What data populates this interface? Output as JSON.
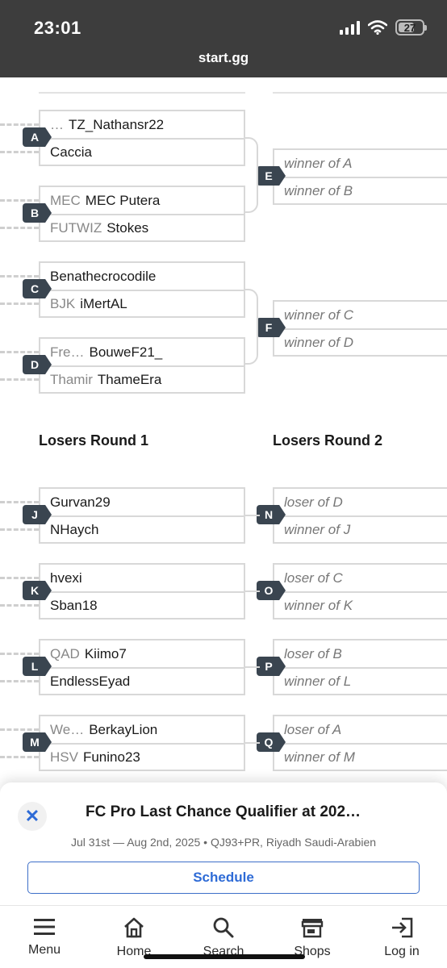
{
  "status": {
    "time": "23:01",
    "battery": "27"
  },
  "browser": {
    "url": "start.gg"
  },
  "bracket": {
    "round1": [
      {
        "id": "A",
        "p1": {
          "prefix": "…",
          "name": "TZ_Nathansr22"
        },
        "p2": {
          "prefix": "",
          "name": "Caccia"
        }
      },
      {
        "id": "B",
        "p1": {
          "prefix": "MEC",
          "name": "MEC Putera"
        },
        "p2": {
          "prefix": "FUTWIZ",
          "name": "Stokes"
        }
      },
      {
        "id": "C",
        "p1": {
          "prefix": "",
          "name": "Benathecrocodile"
        },
        "p2": {
          "prefix": "BJK",
          "name": "iMertAL"
        }
      },
      {
        "id": "D",
        "p1": {
          "prefix": "Fre…",
          "name": "BouweF21_"
        },
        "p2": {
          "prefix": "Thamir",
          "name": "ThameEra"
        }
      }
    ],
    "round2": [
      {
        "id": "E",
        "s1": "winner of A",
        "s2": "winner of B"
      },
      {
        "id": "F",
        "s1": "winner of C",
        "s2": "winner of D"
      }
    ],
    "losers_round1_title": "Losers Round 1",
    "losers_round2_title": "Losers Round 2",
    "losers1": [
      {
        "id": "J",
        "p1": {
          "prefix": "",
          "name": "Gurvan29"
        },
        "p2": {
          "prefix": "",
          "name": "NHaych"
        }
      },
      {
        "id": "K",
        "p1": {
          "prefix": "",
          "name": "hvexi"
        },
        "p2": {
          "prefix": "",
          "name": "Sban18"
        }
      },
      {
        "id": "L",
        "p1": {
          "prefix": "QAD",
          "name": "Kiimo7"
        },
        "p2": {
          "prefix": "",
          "name": "EndlessEyad"
        }
      },
      {
        "id": "M",
        "p1": {
          "prefix": "We…",
          "name": "BerkayLion"
        },
        "p2": {
          "prefix": "HSV",
          "name": "Funino23"
        }
      }
    ],
    "losers2": [
      {
        "id": "N",
        "s1": "loser of D",
        "s2": "winner of J"
      },
      {
        "id": "O",
        "s1": "loser of C",
        "s2": "winner of K"
      },
      {
        "id": "P",
        "s1": "loser of B",
        "s2": "winner of L"
      },
      {
        "id": "Q",
        "s1": "loser of A",
        "s2": "winner of M"
      }
    ]
  },
  "event": {
    "close_icon": "close-icon",
    "title": "FC Pro Last Chance Qualifier at 202…",
    "subtitle": "Jul 31st — Aug 2nd, 2025 • QJ93+PR, Riyadh Saudi-Arabien",
    "schedule_label": "Schedule"
  },
  "nav": {
    "items": [
      {
        "label": "Menu",
        "icon": "menu-icon"
      },
      {
        "label": "Home",
        "icon": "home-icon"
      },
      {
        "label": "Search",
        "icon": "search-icon"
      },
      {
        "label": "Shops",
        "icon": "shop-icon"
      },
      {
        "label": "Log in",
        "icon": "login-icon"
      }
    ]
  },
  "colors": {
    "chrome": "#3d3d3d",
    "badge": "#3a4550",
    "accent": "#2e6bd6",
    "border": "#d8d8d8"
  }
}
